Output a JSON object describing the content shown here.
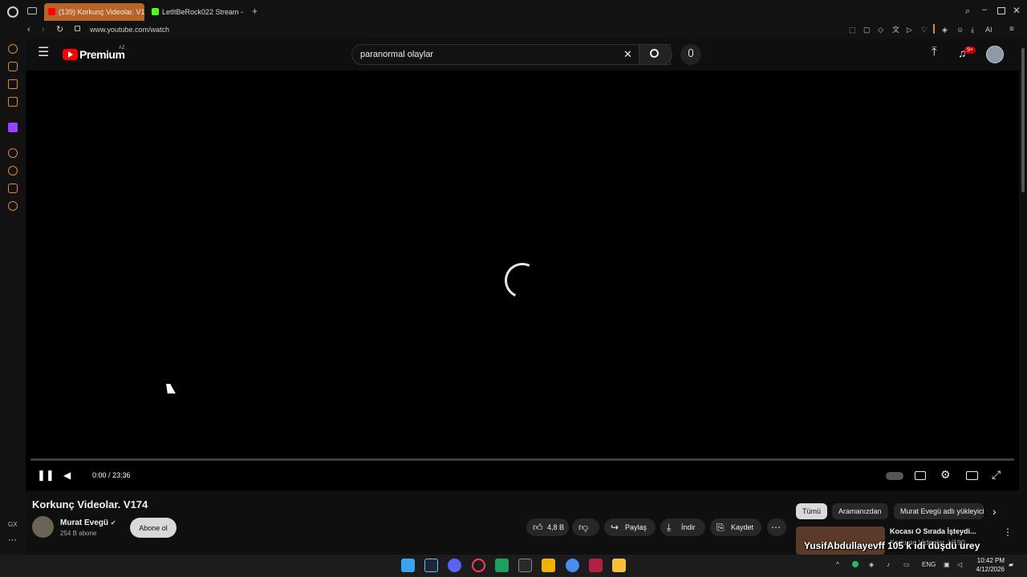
{
  "browser": {
    "tabs": [
      {
        "label": "(139) Korkunç Videolar. V1",
        "active": true
      },
      {
        "label": "LetItBeRock022 Stream - Y",
        "active": false
      }
    ],
    "url": "www.youtube.com/watch",
    "ai_label": "AI"
  },
  "youtube": {
    "logo_text": "Premium",
    "region": "AZ",
    "search_value": "paranormal olaylar",
    "notification_badge": "9+"
  },
  "player": {
    "time": "0:00 / 23:36",
    "progress": 0
  },
  "video": {
    "title": "Korkunç Videolar. V174",
    "channel": "Murat Evegü",
    "subscribers": "254 B abone",
    "subscribe_label": "Abone ol",
    "likes": "4,8 B",
    "share_label": "Paylaş",
    "download_label": "İndir",
    "save_label": "Kaydet"
  },
  "filters": {
    "chips": [
      "Tümü",
      "Aramanızdan",
      "Murat Evegü adlı yükleyici"
    ]
  },
  "suggestion": {
    "title": "Kocası O Sırada İşteydi...",
    "subtitle": "Korkunç Videolar. V190",
    "overlay": "YusifAbdullayevff 105 k idi düşdü urey"
  },
  "side": {
    "gx_label": "GX"
  },
  "taskbar": {
    "lang": "ENG",
    "time": "10:42 PM",
    "date": "4/12/2026"
  },
  "colors": {
    "accent": "#b5652a",
    "youtube_red": "#ff0000",
    "sidebar_icon": "#e08a2e"
  }
}
